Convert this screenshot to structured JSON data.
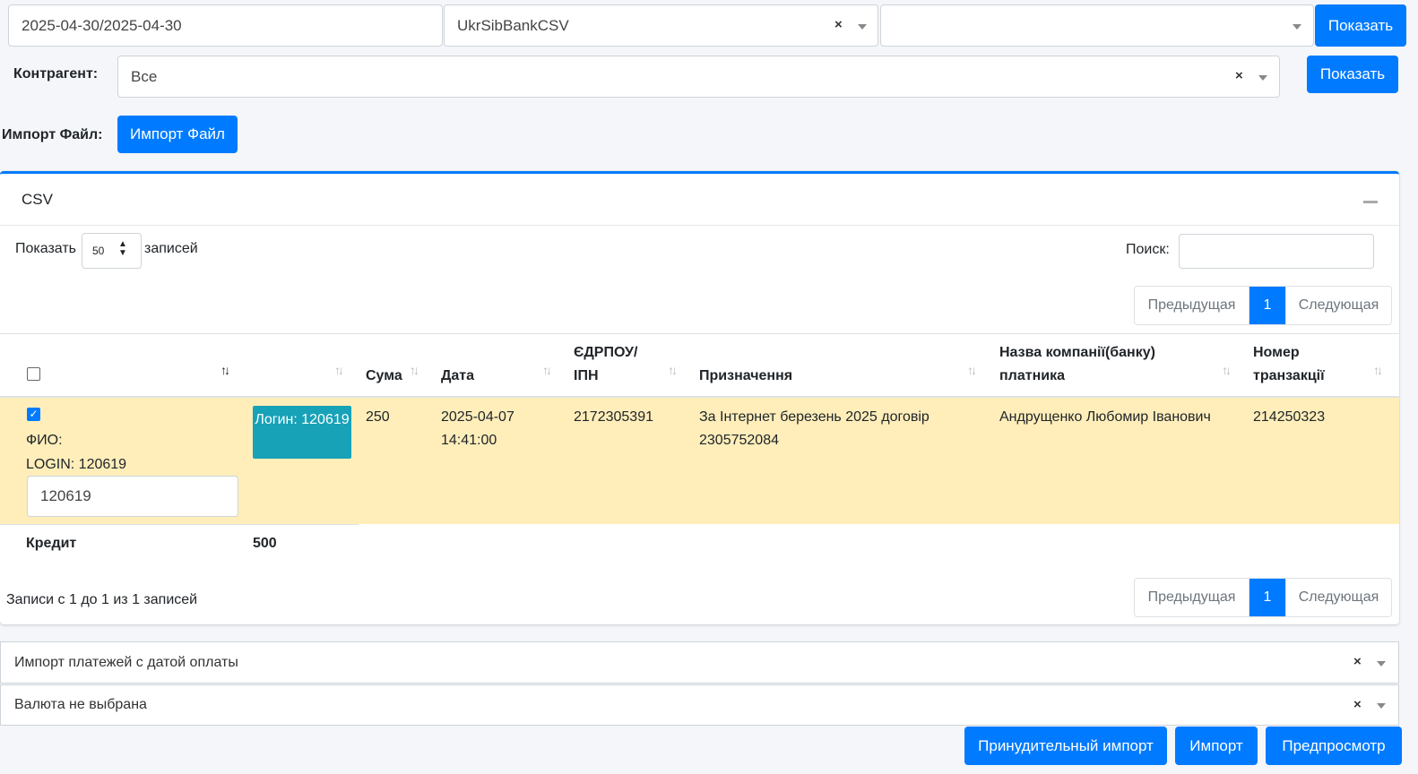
{
  "filters": {
    "date_range": "2025-04-30/2025-04-30",
    "bank_format": "UkrSibBankCSV",
    "third_select": "",
    "show_label": "Показать"
  },
  "contractor": {
    "label": "Контрагент:",
    "value": "Все",
    "show_label": "Показать"
  },
  "import_file": {
    "label": "Импорт Файл:",
    "button_label": "Импорт Файл"
  },
  "card": {
    "title": "CSV",
    "length_prefix": "Показать",
    "length_value": "50",
    "length_suffix": "записей",
    "search_label": "Поиск:",
    "search_value": "",
    "pager": {
      "prev": "Предыдущая",
      "page": "1",
      "next": "Следующая"
    },
    "table": {
      "headers": [
        "",
        "",
        "Сума",
        "Дата",
        "ЄДРПОУ/ ІПН",
        "Призначення",
        "Назва компанії(банку) платника",
        "Номер транзакції"
      ],
      "rows": [
        {
          "checked": true,
          "fio_label": "ФИО:",
          "login_text": "LOGIN: 120619",
          "login_input": "120619",
          "login_button": "Логин: 120619",
          "sum": "250",
          "date": "2025-04-07 14:41:00",
          "edrpou": "2172305391",
          "purpose": "За Інтернет березень 2025 договір 2305752084",
          "payer": "Андрущенко Любомир Іванович",
          "transaction": "214250323"
        }
      ],
      "footer": {
        "label": "Кредит",
        "value": "500"
      }
    },
    "info": "Записи с 1 до 1 из 1 записей"
  },
  "bottom": {
    "import_mode": "Импорт платежей с датой оплаты",
    "currency": "Валюта не выбрана",
    "buttons": {
      "force": "Принудительный импорт",
      "import": "Импорт",
      "preview": "Предпросмотр"
    }
  },
  "colors": {
    "primary": "#007bff",
    "info": "#17a2b8",
    "row_highlight": "#ffeeba"
  }
}
